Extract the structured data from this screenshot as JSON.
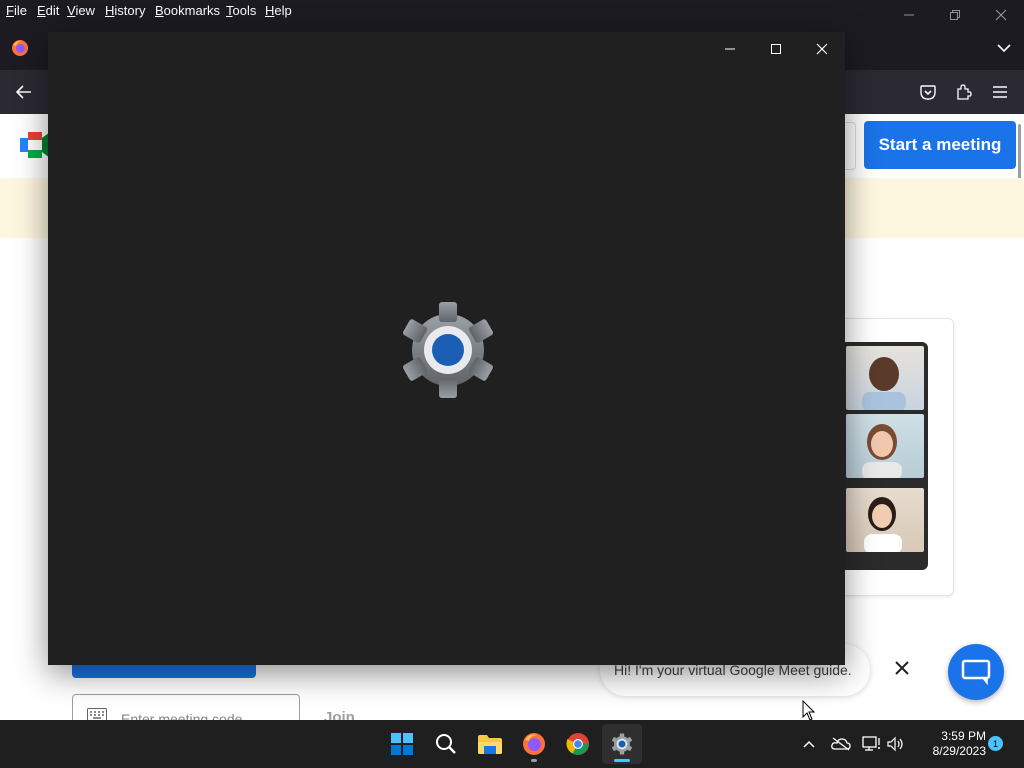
{
  "browser": {
    "menu": [
      {
        "id": "file",
        "label": "File"
      },
      {
        "id": "edit",
        "label": "Edit"
      },
      {
        "id": "view",
        "label": "View"
      },
      {
        "id": "history",
        "label": "History"
      },
      {
        "id": "bookmarks",
        "label": "Bookmarks"
      },
      {
        "id": "tools",
        "label": "Tools"
      },
      {
        "id": "help",
        "label": "Help"
      }
    ],
    "window_controls": [
      "minimize-icon",
      "restore-icon",
      "close-icon"
    ]
  },
  "page": {
    "start_meeting_label": "Start a meeting",
    "meeting_code_placeholder": "Enter meeting code",
    "join_label": "Join",
    "guide_text": "Hi! I'm your virtual Google Meet guide.",
    "colors": {
      "accent": "#1a73e8",
      "banner": "#fef7e0"
    }
  },
  "settings_window": {
    "controls": [
      "minimize-icon",
      "maximize-icon",
      "close-icon"
    ],
    "background": "#202020",
    "splash_icon": "settings-gear-icon"
  },
  "taskbar": {
    "apps": [
      "windows-start-icon",
      "search-icon",
      "file-explorer-icon",
      "firefox-icon",
      "chrome-icon",
      "settings-icon"
    ],
    "active_app": "settings-icon",
    "time": "3:59 PM",
    "date": "8/29/2023",
    "notification_count": "1"
  }
}
